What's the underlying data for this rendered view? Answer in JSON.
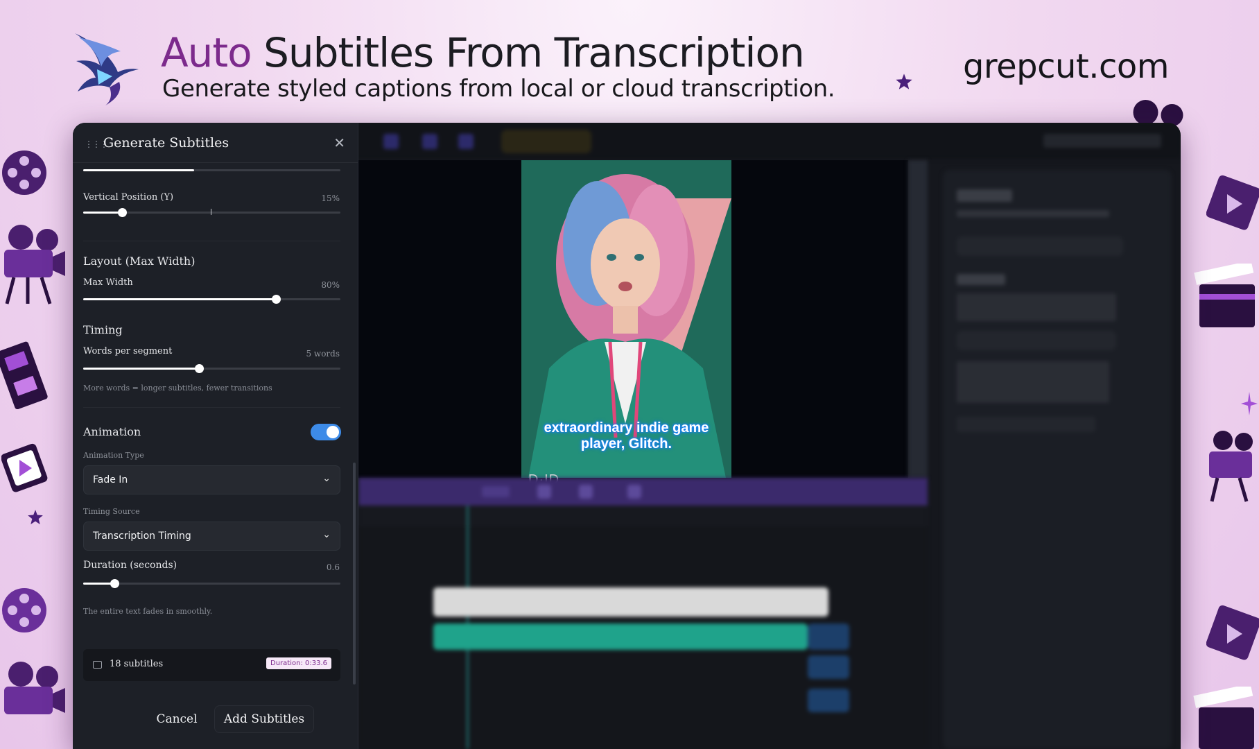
{
  "banner": {
    "title_accent": "Auto",
    "title_rest": " Subtitles From Transcription",
    "subtitle": "Generate styled captions from local or cloud transcription.",
    "site": "grepcut.com"
  },
  "dialog": {
    "title": "Generate Subtitles",
    "vertical_position": {
      "label": "Vertical Position (Y)",
      "value": "15%",
      "fraction": 0.15
    },
    "layout_section": "Layout (Max Width)",
    "max_width": {
      "label": "Max Width",
      "value": "80%",
      "fraction": 0.75
    },
    "timing_section": "Timing",
    "words_per_segment": {
      "label": "Words per segment",
      "value": "5 words",
      "fraction": 0.45,
      "hint": "More words = longer subtitles, fewer transitions"
    },
    "animation": {
      "label": "Animation",
      "enabled": true
    },
    "animation_type": {
      "label": "Animation Type",
      "value": "Fade In"
    },
    "timing_source": {
      "label": "Timing Source",
      "value": "Transcription Timing"
    },
    "duration": {
      "label": "Duration (seconds)",
      "value": "0.6",
      "fraction": 0.12,
      "hint": "The entire text fades in smoothly."
    },
    "summary": {
      "count": "18 subtitles",
      "duration_badge": "Duration: 0:33.6"
    },
    "cancel_label": "Cancel",
    "add_label": "Add Subtitles"
  },
  "preview": {
    "caption": "extraordinary indie game player, Glitch.",
    "watermark": "D·ID"
  },
  "colors": {
    "accent": "#7c2a8c",
    "toggle_on": "#3d8be8",
    "caption_glow": "#1a7fff",
    "timeline_bar": "#3b2a6c"
  }
}
